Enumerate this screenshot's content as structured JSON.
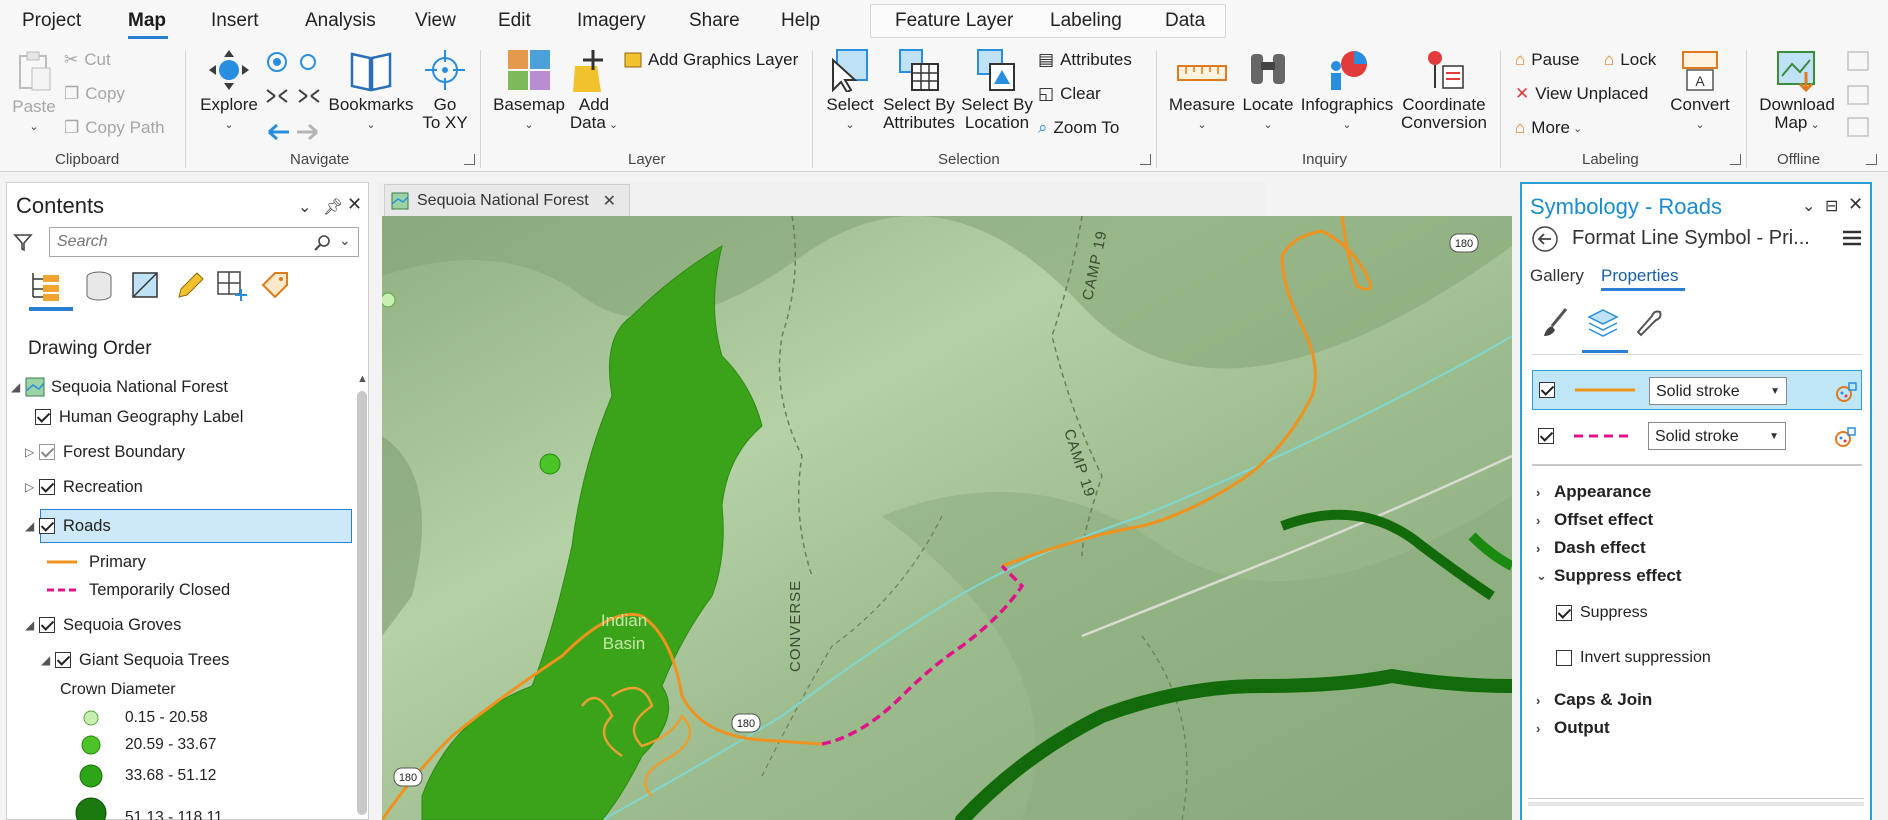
{
  "menu": {
    "tabs": [
      "Project",
      "Map",
      "Insert",
      "Analysis",
      "View",
      "Edit",
      "Imagery",
      "Share",
      "Help"
    ],
    "active": "Map",
    "context_tabs": [
      "Feature Layer",
      "Labeling",
      "Data"
    ]
  },
  "ribbon": {
    "clipboard": {
      "label": "Clipboard",
      "paste": "Paste",
      "cut": "Cut",
      "copy": "Copy",
      "copy_path": "Copy Path"
    },
    "navigate": {
      "label": "Navigate",
      "explore": "Explore",
      "bookmarks": "Bookmarks",
      "goto_l1": "Go",
      "goto_l2": "To XY"
    },
    "layer": {
      "label": "Layer",
      "basemap": "Basemap",
      "add_l1": "Add",
      "add_l2": "Data",
      "add_graphics": "Add Graphics Layer"
    },
    "selection": {
      "label": "Selection",
      "select": "Select",
      "sba_l1": "Select By",
      "sba_l2": "Attributes",
      "sbl_l1": "Select By",
      "sbl_l2": "Location",
      "attributes": "Attributes",
      "clear": "Clear",
      "zoom_to": "Zoom To"
    },
    "inquiry": {
      "label": "Inquiry",
      "measure": "Measure",
      "locate": "Locate",
      "infographics": "Infographics",
      "coord_l1": "Coordinate",
      "coord_l2": "Conversion"
    },
    "labeling": {
      "label": "Labeling",
      "pause": "Pause",
      "lock": "Lock",
      "view_unplaced": "View Unplaced",
      "more": "More",
      "convert": "Convert"
    },
    "offline": {
      "label": "Offline",
      "dl_l1": "Download",
      "dl_l2": "Map"
    }
  },
  "contents": {
    "title": "Contents",
    "search_placeholder": "Search",
    "drawing_order": "Drawing Order",
    "map_name": "Sequoia National Forest",
    "layers": {
      "human_geo": "Human Geography Label",
      "forest_boundary": "Forest Boundary",
      "recreation": "Recreation",
      "roads": "Roads",
      "primary": "Primary",
      "temp_closed": "Temporarily Closed",
      "groves": "Sequoia Groves",
      "giant_trees": "Giant Sequoia Trees",
      "crown_diameter": "Crown Diameter",
      "class1": "0.15 - 20.58",
      "class2": "20.59 - 33.67",
      "class3": "33.68 - 51.12",
      "class4": "51.13 - 118.11"
    }
  },
  "map": {
    "tab_title": "Sequoia National Forest",
    "labels": {
      "camp19_top": "CAMP 19",
      "camp19_mid": "CAMP 19",
      "converse": "CONVERSE",
      "indian": "Indian",
      "basin": "Basin",
      "shield_180_a": "180",
      "shield_180_b": "180",
      "shield_180_c": "180"
    }
  },
  "symbology": {
    "title": "Symbology - Roads",
    "subtitle": "Format Line Symbol - Pri...",
    "tabs": [
      "Gallery",
      "Properties"
    ],
    "active_tab": "Properties",
    "layers": [
      {
        "type": "Solid stroke",
        "color": "#f0921e",
        "dashed": false,
        "checked": true,
        "selected": true
      },
      {
        "type": "Solid stroke",
        "color": "#e0148a",
        "dashed": true,
        "checked": true,
        "selected": false
      }
    ],
    "sections": {
      "appearance": "Appearance",
      "offset": "Offset effect",
      "dash": "Dash effect",
      "suppress": "Suppress effect",
      "suppress_cb": "Suppress",
      "invert_cb": "Invert suppression",
      "caps": "Caps & Join",
      "output": "Output"
    }
  },
  "colors": {
    "accent": "#2a7fd4",
    "road_primary": "#f0921e",
    "road_closed": "#e0148a",
    "grove": "#3aa31a",
    "terrain": "#a9c59a"
  }
}
